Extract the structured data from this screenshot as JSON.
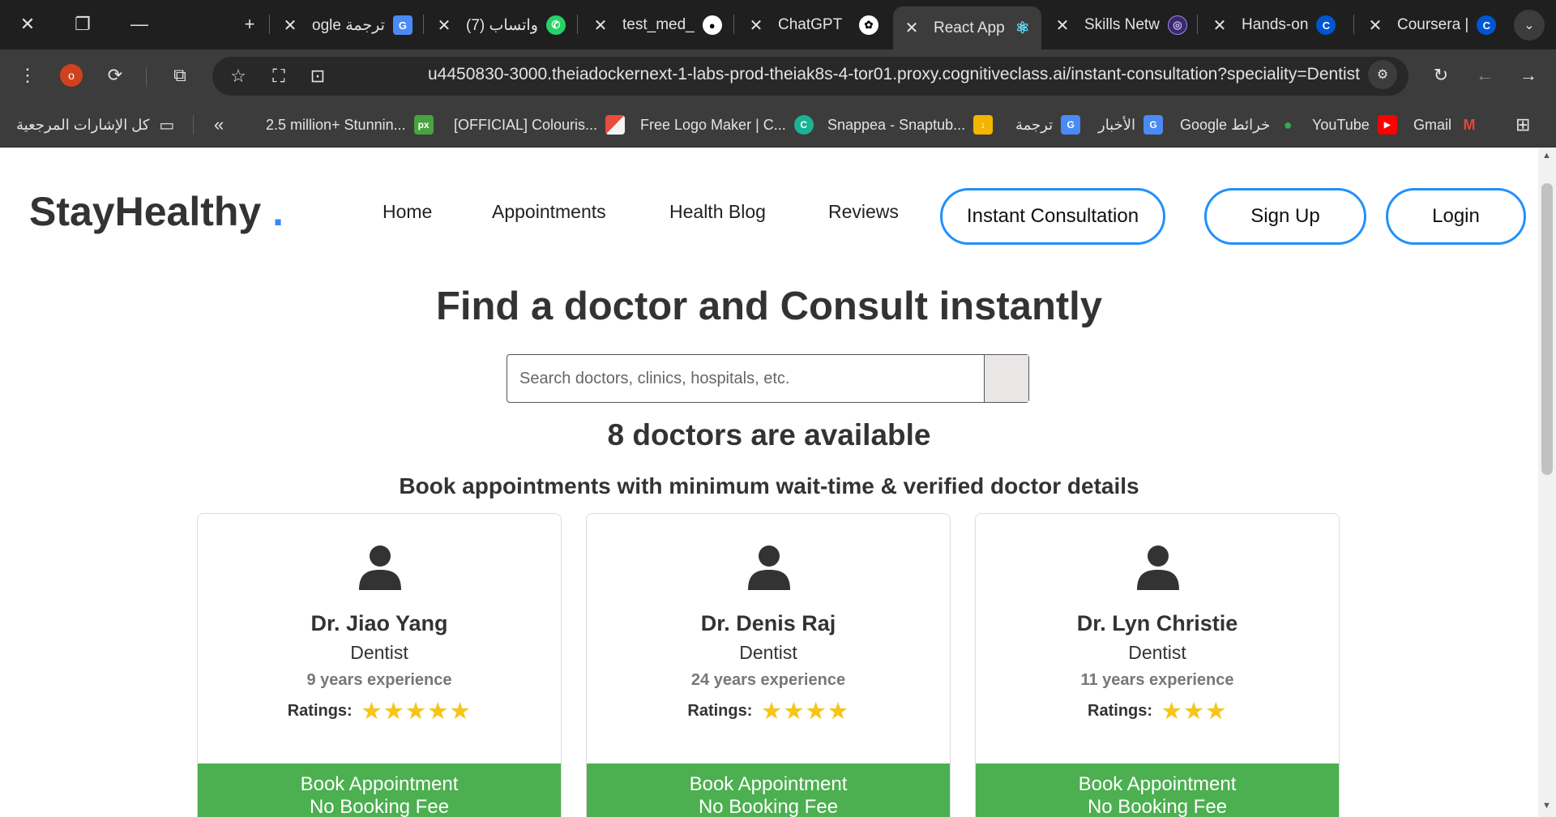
{
  "tabs": [
    {
      "label": "ogle ترجمة",
      "icon": "google-translate-icon"
    },
    {
      "label": "(7) واتساب",
      "icon": "whatsapp-icon"
    },
    {
      "label": "test_med_",
      "icon": "github-icon"
    },
    {
      "label": "ChatGPT",
      "icon": "chatgpt-icon"
    },
    {
      "label": "React App",
      "icon": "react-icon",
      "active": true
    },
    {
      "label": "Skills Netw",
      "icon": "skills-network-icon"
    },
    {
      "label": "Hands-on",
      "icon": "coursera-icon"
    },
    {
      "label": "Coursera |",
      "icon": "coursera-icon"
    }
  ],
  "address_bar": {
    "url": "u4450830-3000.theiadockernext-1-labs-prod-theiak8s-4-tor01.proxy.cognitiveclass.ai/instant-consultation?speciality=Dentist",
    "profile_initial": "o"
  },
  "bookmarks": {
    "all_bookmarks": "كل الإشارات المرجعية",
    "items": [
      {
        "label": "2.5 million+ Stunnin...",
        "icon": "pixabay-icon",
        "color": "#48a23f",
        "glyph": "px"
      },
      {
        "label": "[OFFICIAL] Colouris...",
        "icon": "colourise-icon",
        "color": "#e84c3d",
        "glyph": ""
      },
      {
        "label": "Free Logo Maker | C...",
        "icon": "logo-maker-icon",
        "color": "#1ab394",
        "glyph": "C"
      },
      {
        "label": "Snappea - Snaptub...",
        "icon": "snappea-icon",
        "color": "#f5b400",
        "glyph": "↓"
      },
      {
        "label": "ترجمة",
        "icon": "google-translate-icon",
        "color": "#4a8af4",
        "glyph": "G"
      },
      {
        "label": "الأخبار",
        "icon": "google-news-icon",
        "color": "#4a8af4",
        "glyph": "G"
      },
      {
        "label": "Google خرائط",
        "icon": "google-maps-icon",
        "color": "#34a853",
        "glyph": "●"
      },
      {
        "label": "YouTube",
        "icon": "youtube-icon",
        "color": "#ff0000",
        "glyph": "▶"
      },
      {
        "label": "Gmail",
        "icon": "gmail-icon",
        "color": "#ea4335",
        "glyph": "M"
      }
    ]
  },
  "site": {
    "logo": "StayHealthy",
    "logo_dot": ".",
    "nav": {
      "home": "Home",
      "appointments": "Appointments",
      "health_blog": "Health Blog",
      "reviews": "Reviews",
      "instant_consultation": "Instant Consultation",
      "sign_up": "Sign Up",
      "login": "Login"
    },
    "heading": "Find a doctor and Consult instantly",
    "search_placeholder": "Search doctors, clinics, hospitals, etc.",
    "available_count": "8 doctors are available",
    "subtitle": "Book appointments with minimum wait-time & verified doctor details",
    "ratings_label": "Ratings:",
    "book_line1": "Book Appointment",
    "book_line2": "No Booking Fee",
    "accent_color": "#2190ff",
    "book_color": "#4caf50",
    "star_color": "#f5c518"
  },
  "doctors": [
    {
      "name": "Dr. Jiao Yang",
      "speciality": "Dentist",
      "experience": "9 years experience",
      "rating": 5
    },
    {
      "name": "Dr. Denis Raj",
      "speciality": "Dentist",
      "experience": "24 years experience",
      "rating": 4
    },
    {
      "name": "Dr. Lyn Christie",
      "speciality": "Dentist",
      "experience": "11 years experience",
      "rating": 3
    }
  ]
}
